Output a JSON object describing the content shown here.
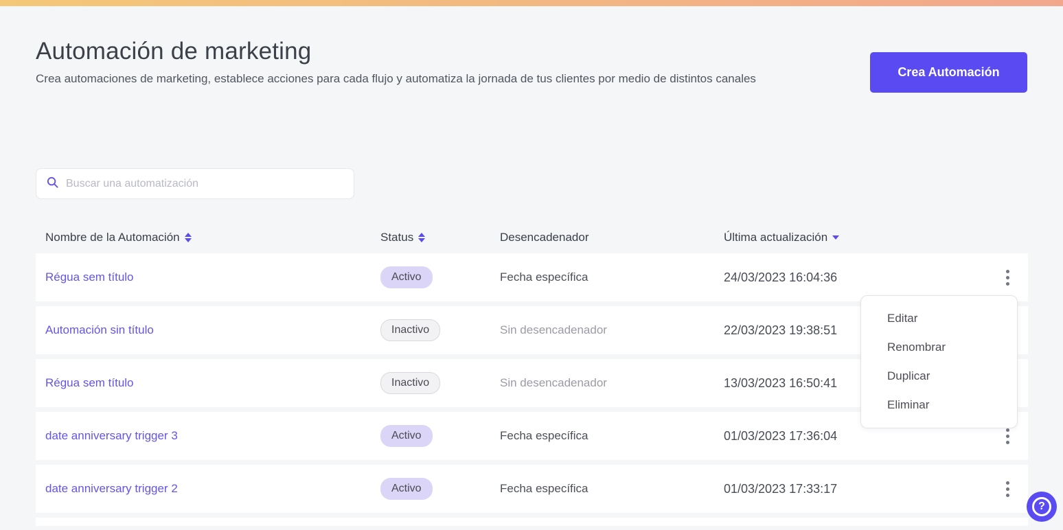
{
  "page": {
    "title": "Automación de marketing",
    "subtitle": "Crea automaciones de marketing, establece acciones para cada flujo y automatiza la jornada de tus clientes por medio de distintos canales",
    "create_button_label": "Crea Automación"
  },
  "colors": {
    "accent": "#5a4af2",
    "link": "#6355e8",
    "top_gradient_left": "#f3c878",
    "top_gradient_right": "#f2a78c",
    "badge_active_bg": "#dbd5f7",
    "badge_inactive_bg": "#f2f2f5"
  },
  "search": {
    "placeholder": "Buscar una automatización",
    "value": ""
  },
  "table": {
    "columns": {
      "name": "Nombre de la Automación",
      "status": "Status",
      "trigger": "Desencadenador",
      "updated": "Última actualización"
    },
    "sort": {
      "column": "Última actualización",
      "direction": "desc"
    },
    "rows": [
      {
        "name": "Régua sem título",
        "status": "Activo",
        "status_variant": "active",
        "trigger": "Fecha específica",
        "trigger_variant": "normal",
        "updated": "24/03/2023 16:04:36"
      },
      {
        "name": "Automación sin título",
        "status": "Inactivo",
        "status_variant": "inactive",
        "trigger": "Sin desencadenador",
        "trigger_variant": "muted",
        "updated": "22/03/2023 19:38:51"
      },
      {
        "name": "Régua sem título",
        "status": "Inactivo",
        "status_variant": "inactive",
        "trigger": "Sin desencadenador",
        "trigger_variant": "muted",
        "updated": "13/03/2023 16:50:41"
      },
      {
        "name": "date anniversary trigger 3",
        "status": "Activo",
        "status_variant": "active",
        "trigger": "Fecha específica",
        "trigger_variant": "normal",
        "updated": "01/03/2023 17:36:04"
      },
      {
        "name": "date anniversary trigger 2",
        "status": "Activo",
        "status_variant": "active",
        "trigger": "Fecha específica",
        "trigger_variant": "normal",
        "updated": "01/03/2023 17:33:17"
      }
    ]
  },
  "context_menu": {
    "items": [
      "Editar",
      "Renombrar",
      "Duplicar",
      "Eliminar"
    ]
  },
  "help_button": {
    "glyph": "?"
  }
}
